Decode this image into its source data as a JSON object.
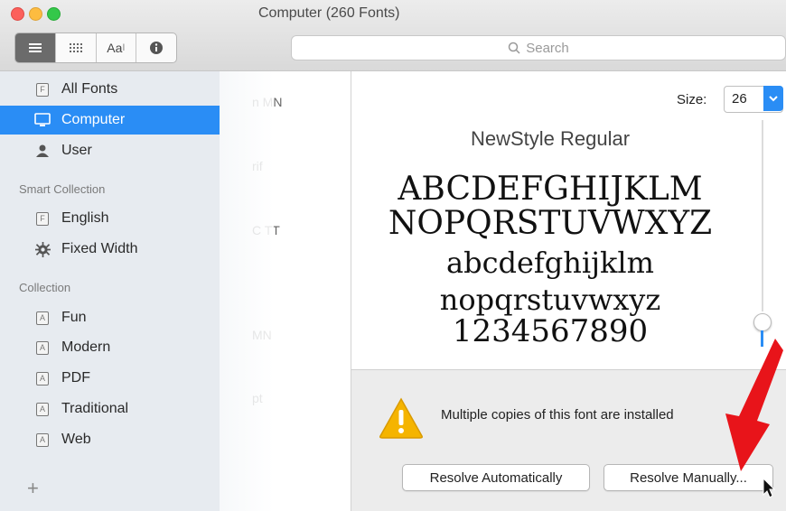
{
  "window": {
    "title": "Computer (260 Fonts)"
  },
  "toolbar": {
    "view_buttons": [
      "list-view",
      "grid-view",
      "sample-view",
      "info-view"
    ],
    "sample_label": "Aa",
    "search_placeholder": "Search"
  },
  "sidebar": {
    "items": [
      {
        "label": "All Fonts",
        "icon": "font-file-icon"
      },
      {
        "label": "Computer",
        "icon": "monitor-icon",
        "selected": true
      },
      {
        "label": "User",
        "icon": "user-icon"
      }
    ],
    "smart_heading": "Smart Collection",
    "smart_items": [
      {
        "label": "English",
        "icon": "font-file-icon"
      },
      {
        "label": "Fixed Width",
        "icon": "gear-icon"
      }
    ],
    "collection_heading": "Collection",
    "collection_items": [
      {
        "label": "Fun"
      },
      {
        "label": "Modern"
      },
      {
        "label": "PDF"
      },
      {
        "label": "Traditional"
      },
      {
        "label": "Web"
      }
    ],
    "add_label": "+"
  },
  "font_list": [
    "n MN",
    "rif",
    "C TT",
    "MN",
    "pt"
  ],
  "preview": {
    "size_label": "Size:",
    "size_value": "26",
    "font_name": "NewStyle Regular",
    "lines": [
      "ABCDEFGHIJKLM",
      "NOPQRSTUVWXYZ",
      "abcdefghijklm",
      "nopqrstuvwxyz",
      "1234567890"
    ]
  },
  "warning": {
    "message": "Multiple copies of this font are installed",
    "resolve_auto": "Resolve Automatically",
    "resolve_manual": "Resolve Manually..."
  },
  "colors": {
    "accent": "#2a8df5",
    "arrow": "#e8141a",
    "warning": "#f5b400"
  }
}
